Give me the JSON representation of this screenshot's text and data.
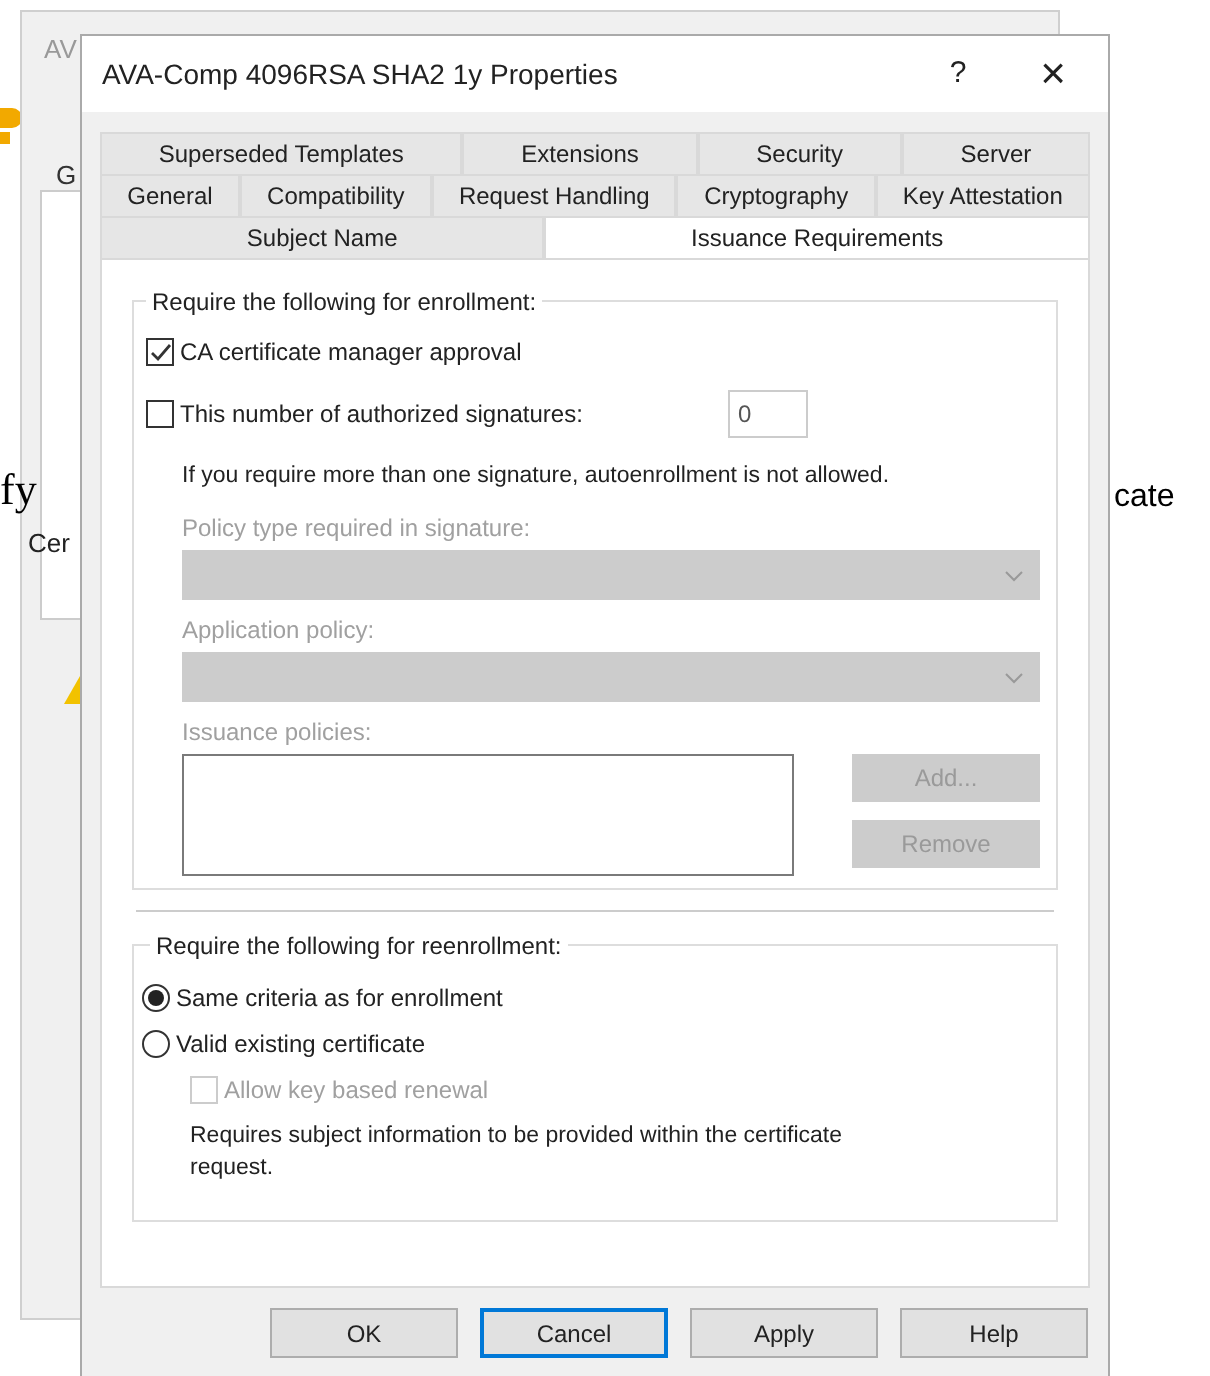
{
  "background_window": {
    "title": "AV",
    "tab": "G",
    "text_left": "fy",
    "label": "Cer",
    "text_right": "cate"
  },
  "dialog": {
    "title": "AVA-Comp 4096RSA SHA2 1y Properties",
    "help": "?",
    "close": "×"
  },
  "tab_rows": [
    [
      {
        "label": "Superseded Templates",
        "selected": false
      },
      {
        "label": "Extensions",
        "selected": false
      },
      {
        "label": "Security",
        "selected": false
      },
      {
        "label": "Server",
        "selected": false
      }
    ],
    [
      {
        "label": "General",
        "selected": false
      },
      {
        "label": "Compatibility",
        "selected": false
      },
      {
        "label": "Request Handling",
        "selected": false
      },
      {
        "label": "Cryptography",
        "selected": false
      },
      {
        "label": "Key Attestation",
        "selected": false
      }
    ],
    [
      {
        "label": "Subject Name",
        "selected": false
      },
      {
        "label": "Issuance Requirements",
        "selected": true
      }
    ]
  ],
  "enrollment": {
    "legend": "Require the following for enrollment:",
    "manager_approval": {
      "label": "CA certificate manager approval",
      "checked": true
    },
    "signatures": {
      "label": "This number of authorized signatures:",
      "checked": false,
      "value": "0"
    },
    "note": "If you require more than one signature, autoenrollment is not allowed.",
    "policy_type": {
      "label": "Policy type required in signature:",
      "disabled": true
    },
    "application_policy": {
      "label": "Application policy:",
      "disabled": true
    },
    "issuance_policies": {
      "label": "Issuance policies:",
      "disabled": true
    },
    "buttons": [
      {
        "label": "Add...",
        "disabled": true
      },
      {
        "label": "Remove",
        "disabled": true
      }
    ]
  },
  "reenrollment": {
    "legend": "Require the following for reenrollment:",
    "options": [
      {
        "label": "Same criteria as for enrollment",
        "selected": true
      },
      {
        "label": "Valid existing certificate",
        "selected": false
      }
    ],
    "key_renewal": {
      "label": "Allow key based renewal",
      "checked": false,
      "disabled": true
    },
    "note": "Requires subject information to be provided within the certificate request."
  },
  "buttons": [
    {
      "label": "OK",
      "focused": false
    },
    {
      "label": "Cancel",
      "focused": true
    },
    {
      "label": "Apply",
      "focused": false
    },
    {
      "label": "Help",
      "focused": false
    }
  ]
}
